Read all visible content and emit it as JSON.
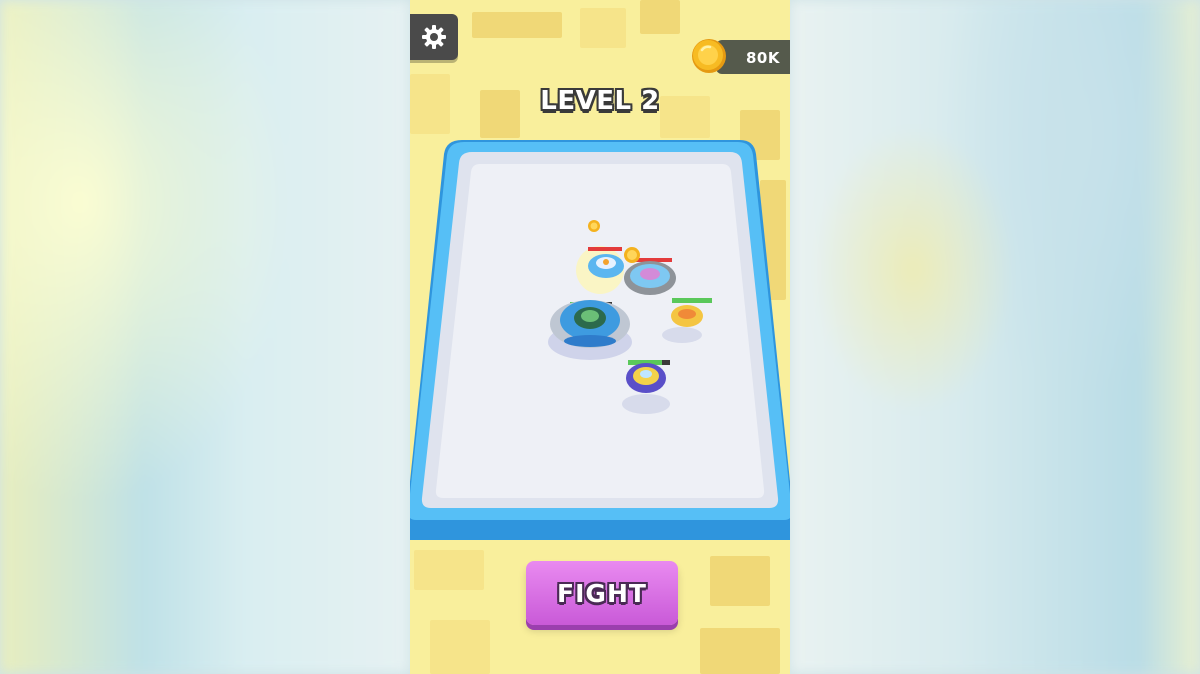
{
  "hud": {
    "settings_icon": "gear-icon",
    "coin_icon": "gold-coin-icon",
    "coins": "80K",
    "level_label": "LEVEL 2"
  },
  "arena": {
    "tops": [
      {
        "name": "player-top",
        "color": "#4aa3e8",
        "health": 1.0
      },
      {
        "name": "enemy-top-1",
        "color": "#5bb6f0",
        "health": 0.6
      },
      {
        "name": "enemy-top-2",
        "color": "#9aa0a6",
        "health": 0.5
      },
      {
        "name": "enemy-top-3",
        "color": "#f6c64a",
        "health": 0.9
      },
      {
        "name": "enemy-top-4",
        "color": "#6a5ad0",
        "health": 0.8
      }
    ]
  },
  "actions": {
    "fight_label": "FIGHT"
  },
  "colors": {
    "background": "#f9ef9c",
    "arena_rim": "#4fb7f3",
    "arena_floor": "#eef0f6",
    "fight_button": "#d66fe3",
    "hud_dark": "#4a4a4a"
  }
}
